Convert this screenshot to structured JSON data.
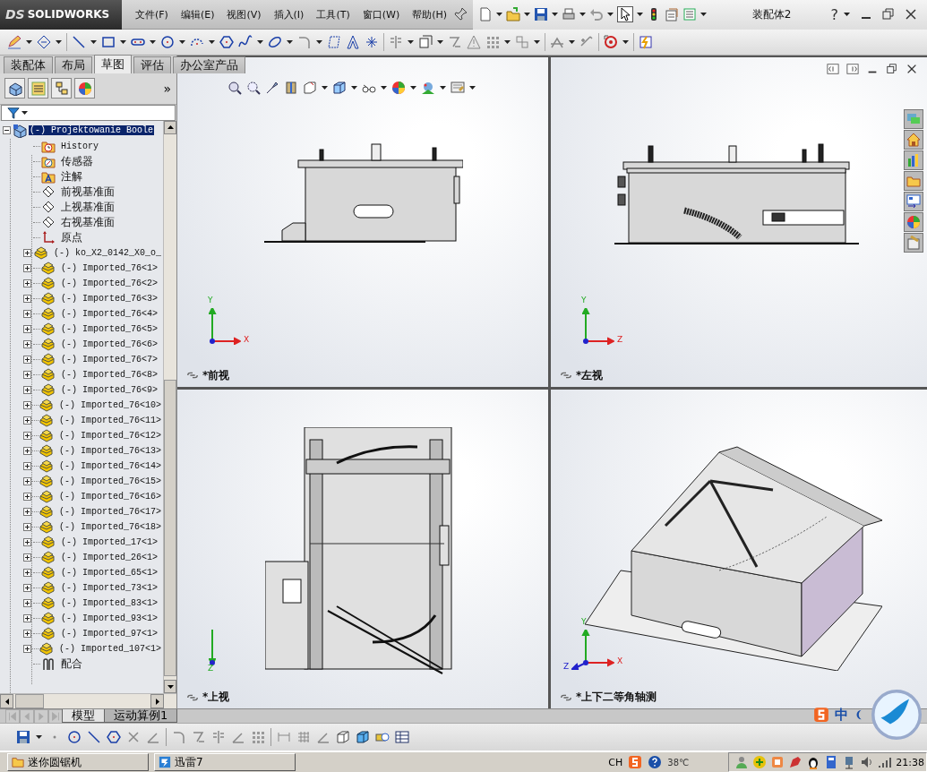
{
  "app": {
    "logo_mark": "DS",
    "logo": "SOLIDWORKS",
    "menu": [
      "文件(F)",
      "编辑(E)",
      "视图(V)",
      "插入(I)",
      "工具(T)",
      "窗口(W)",
      "帮助(H)"
    ],
    "document_title": "装配体2",
    "help": "?"
  },
  "command_tabs": [
    {
      "label": "装配体",
      "selected": false
    },
    {
      "label": "布局",
      "selected": false
    },
    {
      "label": "草图",
      "selected": true
    },
    {
      "label": "评估",
      "selected": false
    },
    {
      "label": "办公室产品",
      "selected": false
    }
  ],
  "panel_more": "»",
  "tree": {
    "root": {
      "label": "(-) Projektowanie Boole",
      "selected": true,
      "expanded": true,
      "children": [
        {
          "label": "History",
          "kind": "history",
          "selected": false
        },
        {
          "label": "传感器",
          "kind": "sensors",
          "selected": false
        },
        {
          "label": "注解",
          "kind": "annotations",
          "selected": false
        },
        {
          "label": "前视基准面",
          "kind": "plane",
          "selected": false
        },
        {
          "label": "上视基准面",
          "kind": "plane",
          "selected": false
        },
        {
          "label": "右视基准面",
          "kind": "plane",
          "selected": false
        },
        {
          "label": "原点",
          "kind": "origin",
          "selected": false
        },
        {
          "label": "(-) ko_X2_0142_X0_o_",
          "kind": "part",
          "selected": false,
          "expanded": false
        },
        {
          "label": "(-) Imported_76<1>",
          "kind": "part",
          "selected": false,
          "expanded": false
        },
        {
          "label": "(-) Imported_76<2>",
          "kind": "part",
          "selected": false,
          "expanded": false
        },
        {
          "label": "(-) Imported_76<3>",
          "kind": "part",
          "selected": false,
          "expanded": false
        },
        {
          "label": "(-) Imported_76<4>",
          "kind": "part",
          "selected": false,
          "expanded": false
        },
        {
          "label": "(-) Imported_76<5>",
          "kind": "part",
          "selected": false,
          "expanded": false
        },
        {
          "label": "(-) Imported_76<6>",
          "kind": "part",
          "selected": false,
          "expanded": false
        },
        {
          "label": "(-) Imported_76<7>",
          "kind": "part",
          "selected": false,
          "expanded": false
        },
        {
          "label": "(-) Imported_76<8>",
          "kind": "part",
          "selected": false,
          "expanded": false
        },
        {
          "label": "(-) Imported_76<9>",
          "kind": "part",
          "selected": false,
          "expanded": false
        },
        {
          "label": "(-) Imported_76<10>",
          "kind": "part",
          "selected": false,
          "expanded": false
        },
        {
          "label": "(-) Imported_76<11>",
          "kind": "part",
          "selected": false,
          "expanded": false
        },
        {
          "label": "(-) Imported_76<12>",
          "kind": "part",
          "selected": false,
          "expanded": false
        },
        {
          "label": "(-) Imported_76<13>",
          "kind": "part",
          "selected": false,
          "expanded": false
        },
        {
          "label": "(-) Imported_76<14>",
          "kind": "part",
          "selected": false,
          "expanded": false
        },
        {
          "label": "(-) Imported_76<15>",
          "kind": "part",
          "selected": false,
          "expanded": false
        },
        {
          "label": "(-) Imported_76<16>",
          "kind": "part",
          "selected": false,
          "expanded": false
        },
        {
          "label": "(-) Imported_76<17>",
          "kind": "part",
          "selected": false,
          "expanded": false
        },
        {
          "label": "(-) Imported_76<18>",
          "kind": "part",
          "selected": false,
          "expanded": false
        },
        {
          "label": "(-) Imported_17<1>",
          "kind": "part",
          "selected": false,
          "expanded": false
        },
        {
          "label": "(-) Imported_26<1>",
          "kind": "part",
          "selected": false,
          "expanded": false
        },
        {
          "label": "(-) Imported_65<1>",
          "kind": "part",
          "selected": false,
          "expanded": false
        },
        {
          "label": "(-) Imported_73<1>",
          "kind": "part",
          "selected": false,
          "expanded": false
        },
        {
          "label": "(-) Imported_83<1>",
          "kind": "part",
          "selected": false,
          "expanded": false
        },
        {
          "label": "(-) Imported_93<1>",
          "kind": "part",
          "selected": false,
          "expanded": false
        },
        {
          "label": "(-) Imported_97<1>",
          "kind": "part",
          "selected": false,
          "expanded": false
        },
        {
          "label": "(-) Imported_107<1>",
          "kind": "part",
          "selected": false,
          "expanded": false
        },
        {
          "label": "配合",
          "kind": "mates",
          "selected": false
        }
      ]
    }
  },
  "views": [
    {
      "label": "*前视",
      "kind": "front",
      "axes": [
        {
          "label": "Y",
          "kind": "up"
        },
        {
          "label": "X",
          "kind": "right"
        }
      ]
    },
    {
      "label": "*左视",
      "kind": "left",
      "axes": [
        {
          "label": "Y",
          "kind": "up"
        },
        {
          "label": "Z",
          "kind": "right"
        }
      ]
    },
    {
      "label": "*上视",
      "kind": "top",
      "axes": [
        {
          "label": "Z",
          "kind": "down"
        }
      ]
    },
    {
      "label": "*上下二等角轴测",
      "kind": "iso",
      "axes": [
        {
          "label": "Y",
          "kind": "up"
        },
        {
          "label": "Z",
          "kind": "leftdown"
        },
        {
          "label": "X",
          "kind": "right"
        }
      ]
    }
  ],
  "bottom_tabs": [
    {
      "label": "模型",
      "selected": true
    },
    {
      "label": "运动算例1",
      "selected": false
    }
  ],
  "ime": {
    "mode": "中"
  },
  "taskbar": {
    "tasks": [
      "迷你圆锯机",
      "迅雷7"
    ],
    "language": "CH",
    "weather": "38℃",
    "clock": "21:38"
  }
}
